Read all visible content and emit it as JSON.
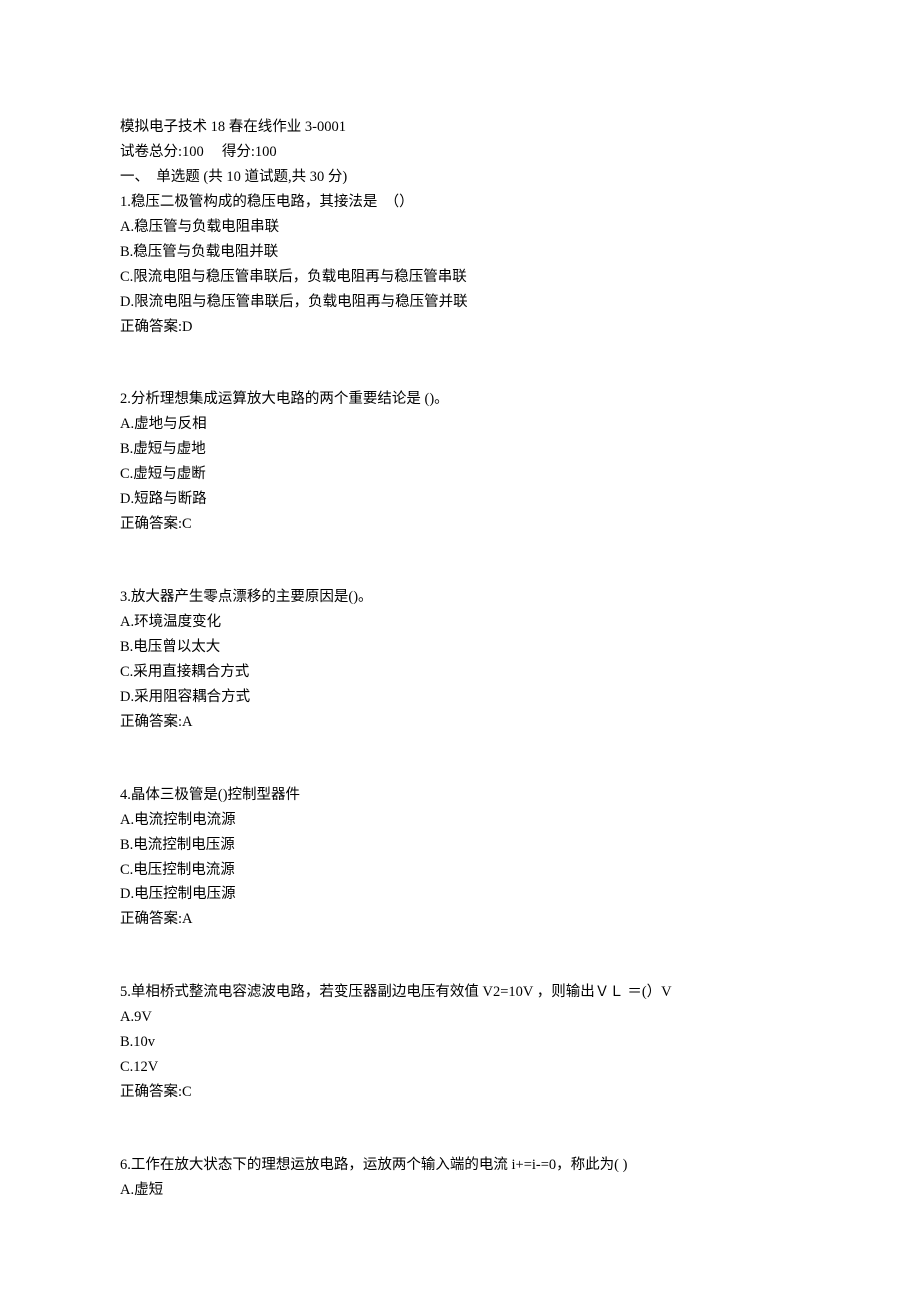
{
  "header": {
    "title": "模拟电子技术 18 春在线作业 3-0001",
    "scoreLine": "试卷总分:100     得分:100",
    "sectionLine": "一、  单选题 (共 10 道试题,共 30 分)"
  },
  "questions": [
    {
      "stem": "1.稳压二极管构成的稳压电路，其接法是  （）",
      "options": [
        "A.稳压管与负载电阻串联",
        "B.稳压管与负载电阻并联",
        "C.限流电阻与稳压管串联后，负载电阻再与稳压管串联",
        "D.限流电阻与稳压管串联后，负载电阻再与稳压管并联"
      ],
      "answer": "正确答案:D"
    },
    {
      "stem": "2.分析理想集成运算放大电路的两个重要结论是 ()。",
      "options": [
        "A.虚地与反相",
        "B.虚短与虚地",
        "C.虚短与虚断",
        "D.短路与断路"
      ],
      "answer": "正确答案:C"
    },
    {
      "stem": "3.放大器产生零点漂移的主要原因是()。",
      "options": [
        "A.环境温度变化",
        "B.电压曾以太大",
        "C.采用直接耦合方式",
        "D.采用阻容耦合方式"
      ],
      "answer": "正确答案:A"
    },
    {
      "stem": "4.晶体三极管是()控制型器件",
      "options": [
        "A.电流控制电流源",
        "B.电流控制电压源",
        "C.电压控制电流源",
        "D.电压控制电压源"
      ],
      "answer": "正确答案:A"
    },
    {
      "stem": "5.单相桥式整流电容滤波电路，若变压器副边电压有效值 V2=10V ，则输出ＶＬ ＝(）V",
      "options": [
        "A.9V",
        "B.10v",
        "C.12V"
      ],
      "answer": "正确答案:C"
    },
    {
      "stem": "6.工作在放大状态下的理想运放电路，运放两个输入端的电流 i+=i-=0，称此为( )",
      "options": [
        "A.虚短"
      ],
      "answer": ""
    }
  ]
}
